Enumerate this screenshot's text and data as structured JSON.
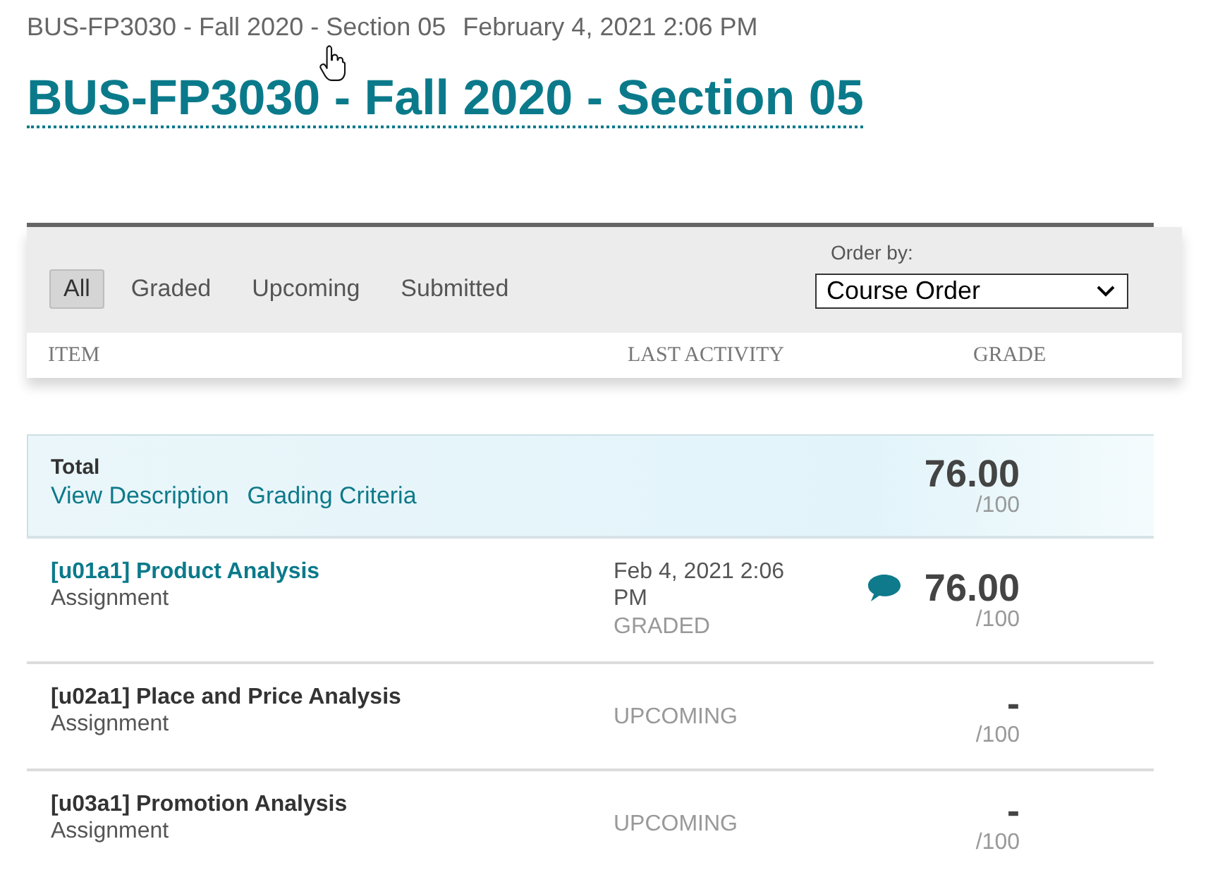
{
  "breadcrumb": {
    "course": "BUS-FP3030 - Fall 2020 - Section 05",
    "timestamp": "February 4, 2021 2:06 PM"
  },
  "title": "BUS-FP3030 - Fall 2020 - Section 05",
  "filters": [
    {
      "label": "All",
      "selected": true
    },
    {
      "label": "Graded",
      "selected": false
    },
    {
      "label": "Upcoming",
      "selected": false
    },
    {
      "label": "Submitted",
      "selected": false
    }
  ],
  "order_by": {
    "label": "Order by:",
    "value": "Course Order"
  },
  "columns": [
    "ITEM",
    "LAST ACTIVITY",
    "GRADE"
  ],
  "total": {
    "label": "Total",
    "links": [
      "View Description",
      "Grading Criteria"
    ],
    "grade": "76.00",
    "max": "/100"
  },
  "items": [
    {
      "title": "[u01a1] Product Analysis",
      "type": "Assignment",
      "linked": true,
      "last_activity": "Feb 4, 2021 2:06 PM",
      "status": "GRADED",
      "has_comment": true,
      "grade": "76.00",
      "max": "/100"
    },
    {
      "title": "[u02a1] Place and Price Analysis",
      "type": "Assignment",
      "linked": false,
      "status": "UPCOMING",
      "has_comment": false,
      "grade": "-",
      "max": "/100"
    },
    {
      "title": "[u03a1] Promotion Analysis",
      "type": "Assignment",
      "linked": false,
      "status": "UPCOMING",
      "has_comment": false,
      "grade": "-",
      "max": "/100"
    }
  ]
}
